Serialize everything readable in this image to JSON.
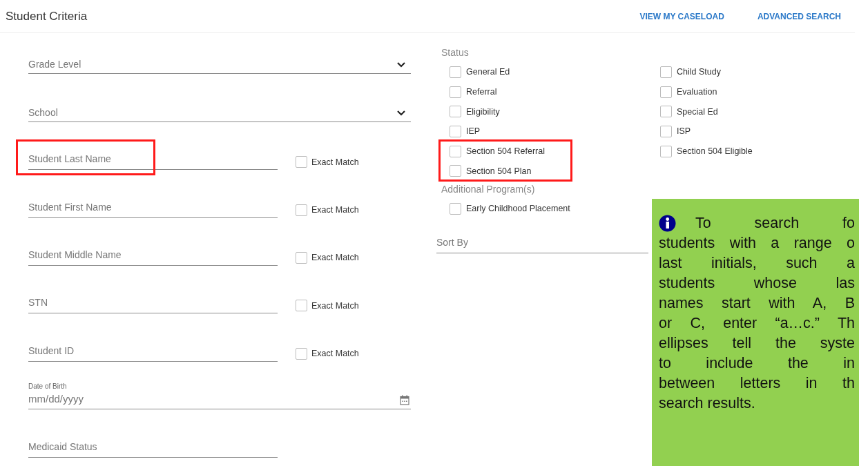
{
  "header": {
    "title": "Student Criteria",
    "links": [
      "VIEW MY CASELOAD",
      "ADVANCED SEARCH"
    ]
  },
  "fields": [
    {
      "kind": "select",
      "placeholder": "Grade Level",
      "highlighted": false
    },
    {
      "kind": "select",
      "placeholder": "School",
      "highlighted": false
    },
    {
      "kind": "text",
      "placeholder": "Student Last Name",
      "highlighted": true,
      "exact_match": {
        "label": "Exact Match",
        "checked": false
      }
    },
    {
      "kind": "text",
      "placeholder": "Student First Name",
      "highlighted": false,
      "exact_match": {
        "label": "Exact Match",
        "checked": false
      }
    },
    {
      "kind": "text",
      "placeholder": "Student Middle Name",
      "highlighted": false,
      "exact_match": {
        "label": "Exact Match",
        "checked": false
      }
    },
    {
      "kind": "text",
      "placeholder": "STN",
      "highlighted": false,
      "exact_match": {
        "label": "Exact Match",
        "checked": false
      }
    },
    {
      "kind": "text",
      "placeholder": "Student ID",
      "highlighted": false,
      "exact_match": {
        "label": "Exact Match",
        "checked": false
      }
    },
    {
      "kind": "date",
      "label": "Date of Birth",
      "placeholder": "mm/dd/yyyy",
      "highlighted": false
    },
    {
      "kind": "text",
      "placeholder": "Medicaid Status",
      "highlighted": false
    }
  ],
  "status": {
    "label": "Status",
    "columns": [
      [
        {
          "label": "General Ed",
          "checked": false,
          "highlighted": false
        },
        {
          "label": "Referral",
          "checked": false,
          "highlighted": false
        },
        {
          "label": "Eligibility",
          "checked": false,
          "highlighted": false
        },
        {
          "label": "IEP",
          "checked": false,
          "highlighted": false
        },
        {
          "label": "Section 504 Referral",
          "checked": false,
          "highlighted": true
        },
        {
          "label": "Section 504 Plan",
          "checked": false,
          "highlighted": true
        }
      ],
      [
        {
          "label": "Child Study",
          "checked": false,
          "highlighted": false
        },
        {
          "label": "Evaluation",
          "checked": false,
          "highlighted": false
        },
        {
          "label": "Special Ed",
          "checked": false,
          "highlighted": false
        },
        {
          "label": "ISP",
          "checked": false,
          "highlighted": false
        },
        {
          "label": "Section 504 Eligible",
          "checked": false,
          "highlighted": false
        }
      ]
    ]
  },
  "additional_programs": {
    "label": "Additional Program(s)",
    "items": [
      {
        "label": "Early Childhood Placement",
        "checked": false
      }
    ]
  },
  "sort_by": {
    "placeholder": "Sort By"
  },
  "callout": {
    "lines": [
      "To search fo",
      "students with a range o",
      "last initials, such a",
      "students whose las",
      "names start with A, B",
      "or C, enter “a…c.” Th",
      "ellipses tell the syste",
      "to include the in",
      "between letters in th",
      "search results."
    ]
  }
}
